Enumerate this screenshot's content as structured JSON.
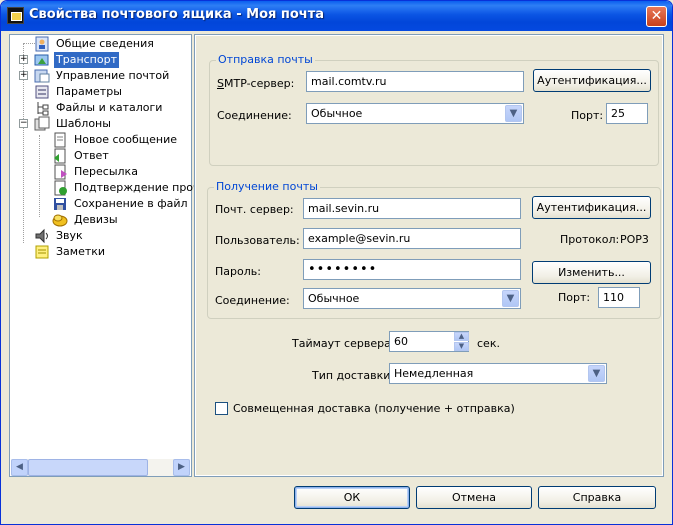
{
  "window": {
    "title": "Свойства почтового ящика - Моя почта"
  },
  "tree": {
    "items": [
      {
        "label": "Общие сведения"
      },
      {
        "label": "Транспорт"
      },
      {
        "label": "Управление почтой"
      },
      {
        "label": "Параметры"
      },
      {
        "label": "Файлы и каталоги"
      },
      {
        "label": "Шаблоны"
      },
      {
        "label": "Новое сообщение"
      },
      {
        "label": "Ответ"
      },
      {
        "label": "Пересылка"
      },
      {
        "label": "Подтверждение прочт"
      },
      {
        "label": "Сохранение в файл"
      },
      {
        "label": "Девизы"
      },
      {
        "label": "Звук"
      },
      {
        "label": "Заметки"
      }
    ]
  },
  "send": {
    "legend": "Отправка почты",
    "smtp_label_u": "S",
    "smtp_label_rest": "MTP-сервер:",
    "smtp_value": "mail.comtv.ru",
    "auth_button": "Аутентификация...",
    "connection_label": "Соединение:",
    "connection_value": "Обычное",
    "port_label": "Порт:",
    "port_value": "25"
  },
  "receive": {
    "legend": "Получение почты",
    "server_label": "Почт. сервер:",
    "server_value": "mail.sevin.ru",
    "auth_button": "Аутентификация...",
    "user_label": "Пользователь:",
    "user_value": "example@sevin.ru",
    "protocol_label": "Протокол:",
    "protocol_value": "POP3",
    "password_label": "Пароль:",
    "password_value": "••••••••",
    "change_button": "Изменить...",
    "connection_label": "Соединение:",
    "connection_value": "Обычное",
    "port_label": "Порт:",
    "port_value": "110"
  },
  "options": {
    "timeout_label": "Таймаут сервера:",
    "timeout_value": "60",
    "timeout_unit": "сек.",
    "delivery_label": "Тип доставки:",
    "delivery_value": "Немедленная",
    "combined_label": "Совмещенная доставка (получение + отправка)",
    "combined_checked": false
  },
  "buttons": {
    "ok": "ОК",
    "cancel": "Отмена",
    "help": "Справка"
  }
}
